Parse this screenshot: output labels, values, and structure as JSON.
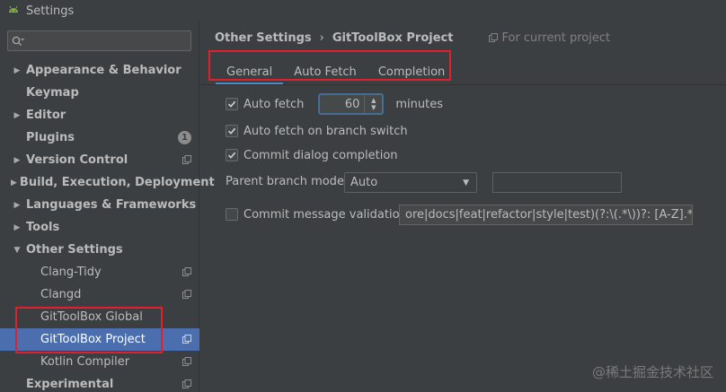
{
  "window": {
    "title": "Settings"
  },
  "sidebar": {
    "search_placeholder": "",
    "items": [
      {
        "label": "Appearance & Behavior",
        "bold": true,
        "arrow": "right"
      },
      {
        "label": "Keymap",
        "bold": true,
        "arrow": "none"
      },
      {
        "label": "Editor",
        "bold": true,
        "arrow": "right"
      },
      {
        "label": "Plugins",
        "bold": true,
        "arrow": "none",
        "badge": "1"
      },
      {
        "label": "Version Control",
        "bold": true,
        "arrow": "right",
        "icon": "project-scope-icon"
      },
      {
        "label": "Build, Execution, Deployment",
        "bold": true,
        "arrow": "right"
      },
      {
        "label": "Languages & Frameworks",
        "bold": true,
        "arrow": "right"
      },
      {
        "label": "Tools",
        "bold": true,
        "arrow": "right"
      },
      {
        "label": "Other Settings",
        "bold": true,
        "arrow": "down"
      },
      {
        "label": "Clang-Tidy",
        "child": true,
        "icon": "project-scope-icon"
      },
      {
        "label": "Clangd",
        "child": true,
        "icon": "project-scope-icon"
      },
      {
        "label": "GitToolBox Global",
        "child": true
      },
      {
        "label": "GitToolBox Project",
        "child": true,
        "selected": true,
        "icon": "project-scope-icon"
      },
      {
        "label": "Kotlin Compiler",
        "child": true,
        "icon": "project-scope-icon"
      },
      {
        "label": "Experimental",
        "bold": true,
        "arrow": "none",
        "icon": "project-scope-icon"
      }
    ]
  },
  "main": {
    "breadcrumb": [
      "Other Settings",
      "GitToolBox Project"
    ],
    "breadcrumb_separator": "›",
    "scope_label": "For current project",
    "tabs": [
      "General",
      "Auto Fetch",
      "Completion"
    ],
    "active_tab": "General",
    "auto_fetch": {
      "label": "Auto fetch",
      "checked": true,
      "value": "60",
      "unit": "minutes"
    },
    "auto_fetch_branch_switch": {
      "label": "Auto fetch on branch switch",
      "checked": true
    },
    "commit_dialog_completion": {
      "label": "Commit dialog completion",
      "checked": true
    },
    "parent_branch_mode": {
      "label": "Parent branch mode",
      "selected": "Auto",
      "extra_value": ""
    },
    "commit_message_validation": {
      "label": "Commit message validation",
      "checked": false,
      "regex": "ore|docs|feat|refactor|style|test)(?:\\(.*\\))?: [A-Z].*\\s#\\d+"
    }
  },
  "watermark": "@稀土掘金技术社区",
  "colors": {
    "background": "#3c3f41",
    "selection": "#4b6eaf",
    "tab_underline": "#4a88c7",
    "highlight_box": "#e0202c"
  }
}
